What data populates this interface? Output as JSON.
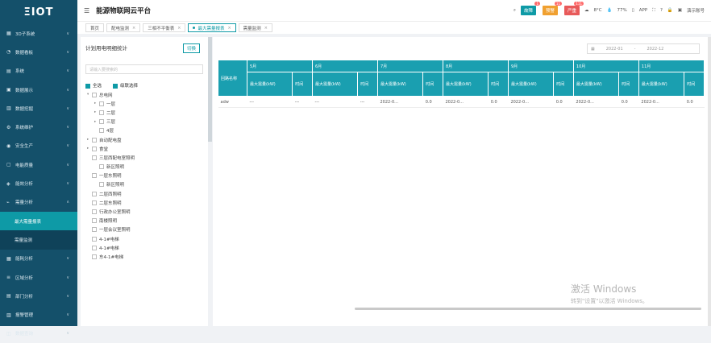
{
  "brand": "ΞIOT",
  "app_title": "能源物联网云平台",
  "sidebar": [
    {
      "icon": "▦",
      "label": "3D子系统",
      "arrow": "∨"
    },
    {
      "icon": "◔",
      "label": "数据看板",
      "arrow": "∨"
    },
    {
      "icon": "▤",
      "label": "系统",
      "arrow": "∨"
    },
    {
      "icon": "▣",
      "label": "数据展示",
      "arrow": "∨"
    },
    {
      "icon": "▥",
      "label": "数据挖掘",
      "arrow": "∨"
    },
    {
      "icon": "⚙",
      "label": "系统维护",
      "arrow": "∨"
    },
    {
      "icon": "◉",
      "label": "安全生产",
      "arrow": "∨"
    },
    {
      "icon": "▢",
      "label": "电能质量",
      "arrow": "∨"
    },
    {
      "icon": "◈",
      "label": "能效分析",
      "arrow": "∨"
    },
    {
      "icon": "⌁",
      "label": "需量分析",
      "arrow": "∧"
    },
    {
      "label": "最大需量报表",
      "sub": true,
      "active": true
    },
    {
      "label": "需量监测",
      "sub": true
    },
    {
      "icon": "▦",
      "label": "能耗分析",
      "arrow": "∨"
    },
    {
      "icon": "≡",
      "label": "区域分析",
      "arrow": "∨"
    },
    {
      "icon": "▤",
      "label": "部门分析",
      "arrow": "∨"
    },
    {
      "icon": "▥",
      "label": "报警管理",
      "arrow": "∨"
    },
    {
      "icon": "◫",
      "label": "数据查询",
      "arrow": "∨"
    }
  ],
  "header": {
    "tags": [
      {
        "label": "故障",
        "count": "1",
        "color": "#0e9aa6"
      },
      {
        "label": "预警",
        "count": "11",
        "color": "#f0a030"
      },
      {
        "label": "严重",
        "count": "111",
        "color": "#e85a5a"
      }
    ],
    "weather": "8°C",
    "humidity": "77%",
    "app": "APP",
    "user": "演示账号"
  },
  "tabs": [
    {
      "label": "首页"
    },
    {
      "label": "配电监测"
    },
    {
      "label": "三相不平衡表"
    },
    {
      "label": "最大需量报表",
      "active": true
    },
    {
      "label": "需量监测"
    }
  ],
  "left": {
    "title": "计划用电明细统计",
    "switch": "切换",
    "search_placeholder": "请输入要搜索的",
    "check_all": "全选",
    "check_related": "级联选择",
    "tree": [
      {
        "depth": 0,
        "caret": "▾",
        "label": "总电网"
      },
      {
        "depth": 1,
        "caret": "▸",
        "label": "一层"
      },
      {
        "depth": 1,
        "caret": "▸",
        "label": "二层"
      },
      {
        "depth": 1,
        "caret": "▸",
        "label": "三层"
      },
      {
        "depth": 1,
        "caret": "",
        "label": "4层"
      },
      {
        "depth": 0,
        "caret": "▸",
        "label": "自动配电盘"
      },
      {
        "depth": 0,
        "caret": "▸",
        "label": "食堂"
      },
      {
        "depth": 0,
        "caret": "",
        "label": "三层西配电室照明"
      },
      {
        "depth": 1,
        "caret": "",
        "label": "新区照明"
      },
      {
        "depth": 0,
        "caret": "",
        "label": "一层东照明"
      },
      {
        "depth": 1,
        "caret": "",
        "label": "新区照明"
      },
      {
        "depth": 0,
        "caret": "",
        "label": "二层西照明"
      },
      {
        "depth": 0,
        "caret": "",
        "label": "二层东照明"
      },
      {
        "depth": 0,
        "caret": "",
        "label": "行政办公室照明"
      },
      {
        "depth": 0,
        "caret": "",
        "label": "南楼照明"
      },
      {
        "depth": 0,
        "caret": "",
        "label": "一层会议室照明"
      },
      {
        "depth": 0,
        "caret": "",
        "label": "4-1#电梯"
      },
      {
        "depth": 0,
        "caret": "",
        "label": "4-1#电梯"
      },
      {
        "depth": 0,
        "caret": "",
        "label": "东4-1#电梯"
      }
    ]
  },
  "right": {
    "date_from": "2022-01",
    "date_sep": "-",
    "date_to": "2022-12",
    "header_name": "回路名称",
    "months": [
      "5月",
      "6月",
      "7月",
      "8月",
      "9月",
      "10月",
      "11月"
    ],
    "sub_headers": [
      "最大需量(kW)",
      "时间",
      "最大需量(kW)",
      "时间",
      "最大需量(kW)",
      "时间",
      "最大需量(kW)",
      "时间",
      "最大需量(kW)",
      "时间",
      "最大需量(kW)",
      "时间",
      "最大需量(kW)",
      "时间"
    ],
    "rows": [
      [
        "adw",
        "---",
        "---",
        "---",
        "---",
        "2022-0...",
        "0.0",
        "2022-0...",
        "0.0",
        "2022-0...",
        "0.0",
        "2022-0...",
        "0.0",
        "2022-0...",
        "0.0"
      ]
    ]
  },
  "watermark": {
    "line1": "激活 Windows",
    "line2": "转到\"设置\"以激活 Windows。"
  }
}
